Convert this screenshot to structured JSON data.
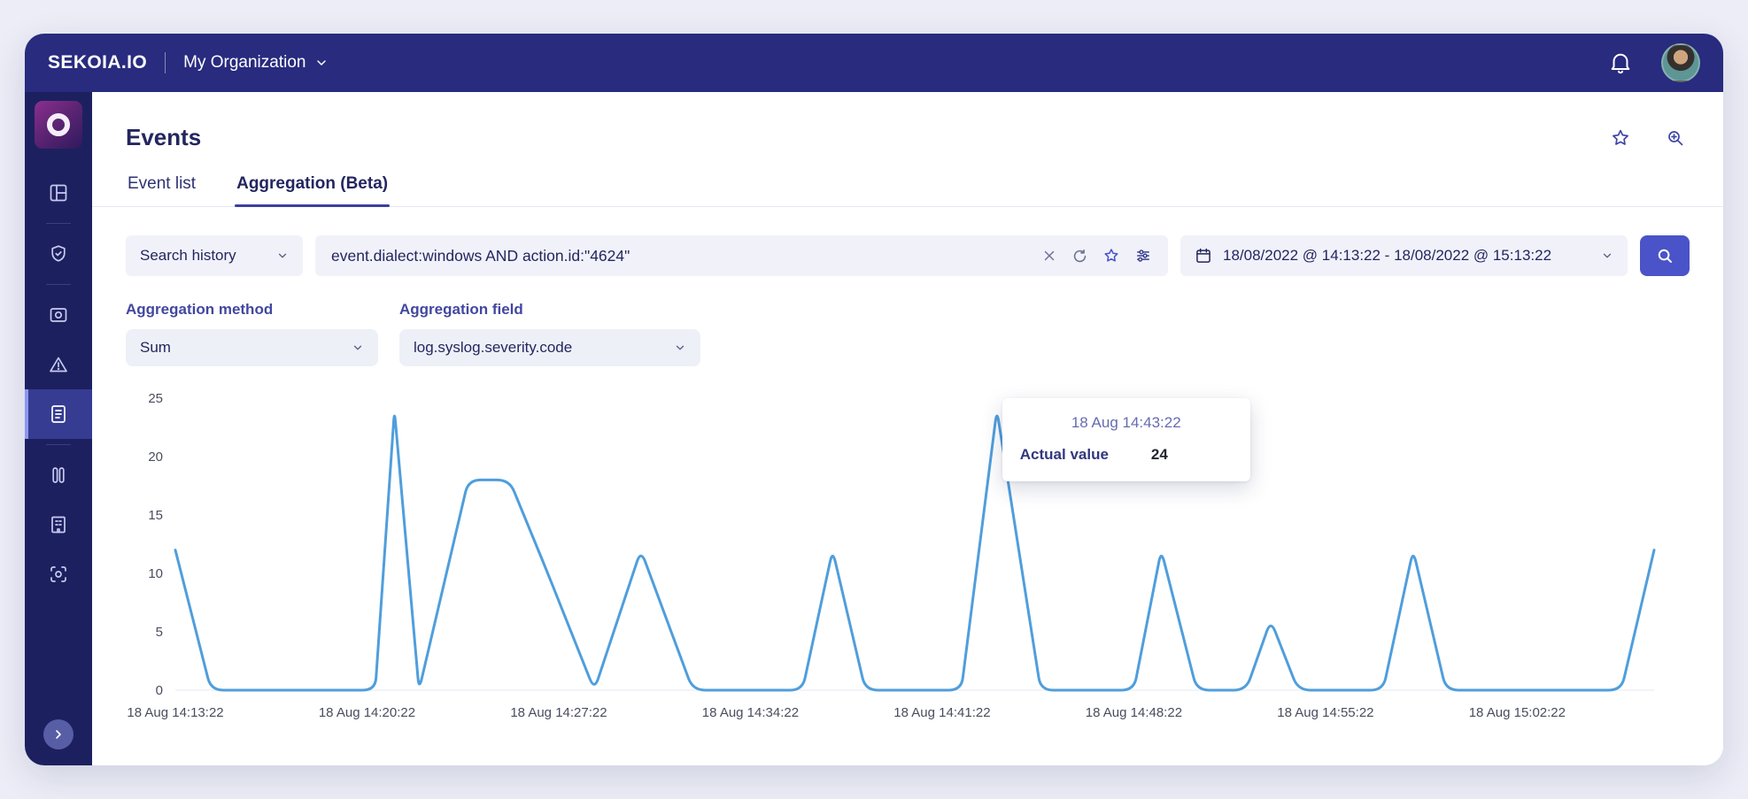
{
  "topbar": {
    "brand": "SEKOIA.IO",
    "org_name": "My Organization"
  },
  "header": {
    "title": "Events"
  },
  "tabs": {
    "event_list": "Event list",
    "aggregation": "Aggregation (Beta)"
  },
  "search": {
    "history_label": "Search history",
    "query": "event.dialect:windows AND action.id:\"4624\"",
    "date_range": "18/08/2022 @ 14:13:22 - 18/08/2022 @ 15:13:22"
  },
  "aggregation": {
    "method_label": "Aggregation method",
    "method_value": "Sum",
    "field_label": "Aggregation field",
    "field_value": "log.syslog.severity.code"
  },
  "tooltip": {
    "time": "18 Aug 14:43:22",
    "label": "Actual value",
    "value": "24",
    "anchor_minutes": 30
  },
  "chart_data": {
    "type": "line",
    "grid": false,
    "legend": false,
    "x_axis": {
      "unit": "time (minutes offset from 14:13:22)",
      "range_minutes": [
        0,
        54
      ],
      "ticks": [
        {
          "t": 0,
          "label": "18 Aug 14:13:22"
        },
        {
          "t": 7,
          "label": "18 Aug 14:20:22"
        },
        {
          "t": 14,
          "label": "18 Aug 14:27:22"
        },
        {
          "t": 21,
          "label": "18 Aug 14:34:22"
        },
        {
          "t": 28,
          "label": "18 Aug 14:41:22"
        },
        {
          "t": 35,
          "label": "18 Aug 14:48:22"
        },
        {
          "t": 42,
          "label": "18 Aug 14:55:22"
        },
        {
          "t": 49,
          "label": "18 Aug 15:02:22"
        }
      ]
    },
    "y_axis": {
      "min": 0,
      "max": 25,
      "ticks": [
        0,
        5,
        10,
        15,
        20,
        25
      ]
    },
    "series": [
      {
        "name": "Actual value",
        "color": "#4f9edc",
        "points_minutes_value": [
          [
            0,
            12
          ],
          [
            1.3,
            0
          ],
          [
            7.3,
            0
          ],
          [
            8,
            24
          ],
          [
            8.9,
            0
          ],
          [
            10.7,
            18
          ],
          [
            12.2,
            18
          ],
          [
            13.6,
            10
          ],
          [
            15.3,
            0
          ],
          [
            17,
            12
          ],
          [
            18.9,
            0
          ],
          [
            22.9,
            0
          ],
          [
            24,
            12
          ],
          [
            25.2,
            0
          ],
          [
            28.7,
            0
          ],
          [
            30,
            24
          ],
          [
            31.6,
            0
          ],
          [
            35,
            0
          ],
          [
            36,
            12
          ],
          [
            37.3,
            0
          ],
          [
            39.1,
            0
          ],
          [
            40,
            6
          ],
          [
            41,
            0
          ],
          [
            44.1,
            0
          ],
          [
            45.2,
            12
          ],
          [
            46.4,
            0
          ],
          [
            52.8,
            0
          ],
          [
            54,
            12
          ]
        ]
      }
    ]
  },
  "icons": {
    "topbar": [
      "chevron-down-icon",
      "bell-icon"
    ],
    "sidebar": [
      "dashboard-icon",
      "shield-check-icon",
      "scope-icon",
      "alert-triangle-icon",
      "events-document-icon",
      "hunting-icon",
      "building-icon",
      "scan-icon",
      "chevron-right-icon"
    ],
    "header": [
      "star-icon",
      "advanced-search-icon"
    ],
    "search_bar": [
      "close-icon",
      "refresh-icon",
      "star-icon",
      "tune-icon",
      "calendar-icon",
      "search-icon",
      "chevron-down-icon"
    ]
  },
  "colors": {
    "topbar": "#282b7e",
    "sidebar": "#1d205f",
    "accent": "#4a53c8",
    "chart_line": "#4f9edc"
  }
}
